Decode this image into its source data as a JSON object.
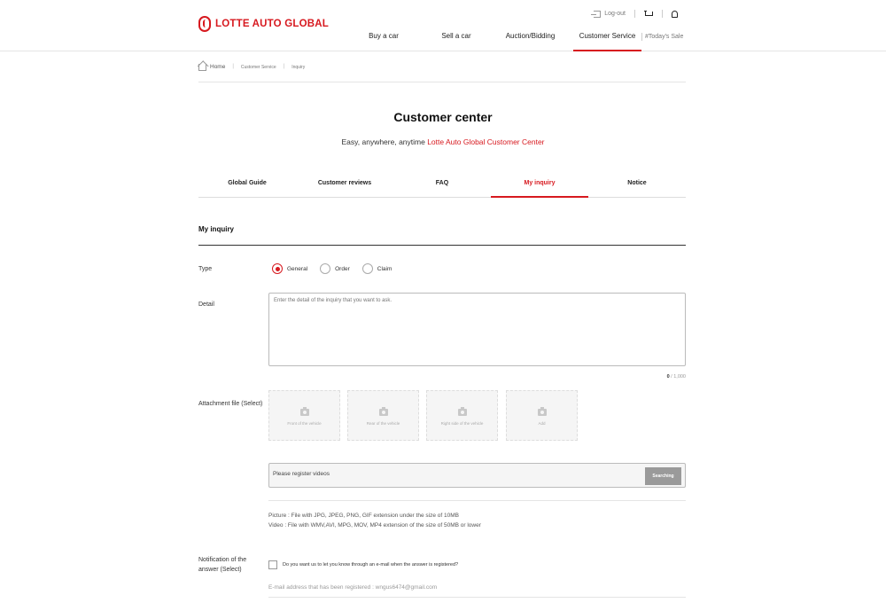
{
  "brand": {
    "name": "LOTTE AUTO GLOBAL",
    "color": "#d7191f"
  },
  "util": {
    "logout": "Log-out",
    "cart_icon": "cart-icon",
    "bell_icon": "bell-icon"
  },
  "gnb": {
    "items": [
      {
        "label": "Buy a car"
      },
      {
        "label": "Sell a car"
      },
      {
        "label": "Auction/Bidding"
      },
      {
        "label": "Customer Service",
        "active": true
      }
    ],
    "sale": "#Today's Sale"
  },
  "breadcrumb": {
    "home": "Home",
    "items": [
      "Customer Service",
      "Inquiry"
    ]
  },
  "page": {
    "title": "Customer center",
    "subtitle_prefix": "Easy, anywhere, anytime ",
    "subtitle_highlight": "Lotte Auto Global Customer Center"
  },
  "tabs": [
    {
      "label": "Global Guide"
    },
    {
      "label": "Customer reviews"
    },
    {
      "label": "FAQ"
    },
    {
      "label": "My inquiry",
      "active": true
    },
    {
      "label": "Notice"
    }
  ],
  "form": {
    "section_title": "My inquiry",
    "type": {
      "label": "Type",
      "options": [
        "General",
        "Order",
        "Claim"
      ],
      "selected": "General"
    },
    "detail": {
      "label": "Detail",
      "placeholder": "Enter the detail of the inquiry that you want to ask.",
      "count": "0",
      "max": "/ 1,000"
    },
    "attachment": {
      "label": "Attachment file (Select)",
      "slots": [
        "Front of the vehicle",
        "Rear of the vehicle",
        "Right side of the vehicle",
        "Add"
      ]
    },
    "video": {
      "placeholder": "Please register videos",
      "button": "Searching"
    },
    "notes": {
      "picture": "Picture : File with JPG, JPEG, PNG, GIF extension under the size of 10MB",
      "video": "Video : File with WMV,AVI, MPG, MOV, MP4 extension of the size of 50MB or lower"
    },
    "notification": {
      "label_line1": "Notification of the",
      "label_line2": "answer (Select)",
      "checkbox_label": "Do you want us to let you know through an e-mail when the answer is registered?",
      "email_note": "E-mail address that has been registered : wngus6474@gmail.com"
    }
  }
}
